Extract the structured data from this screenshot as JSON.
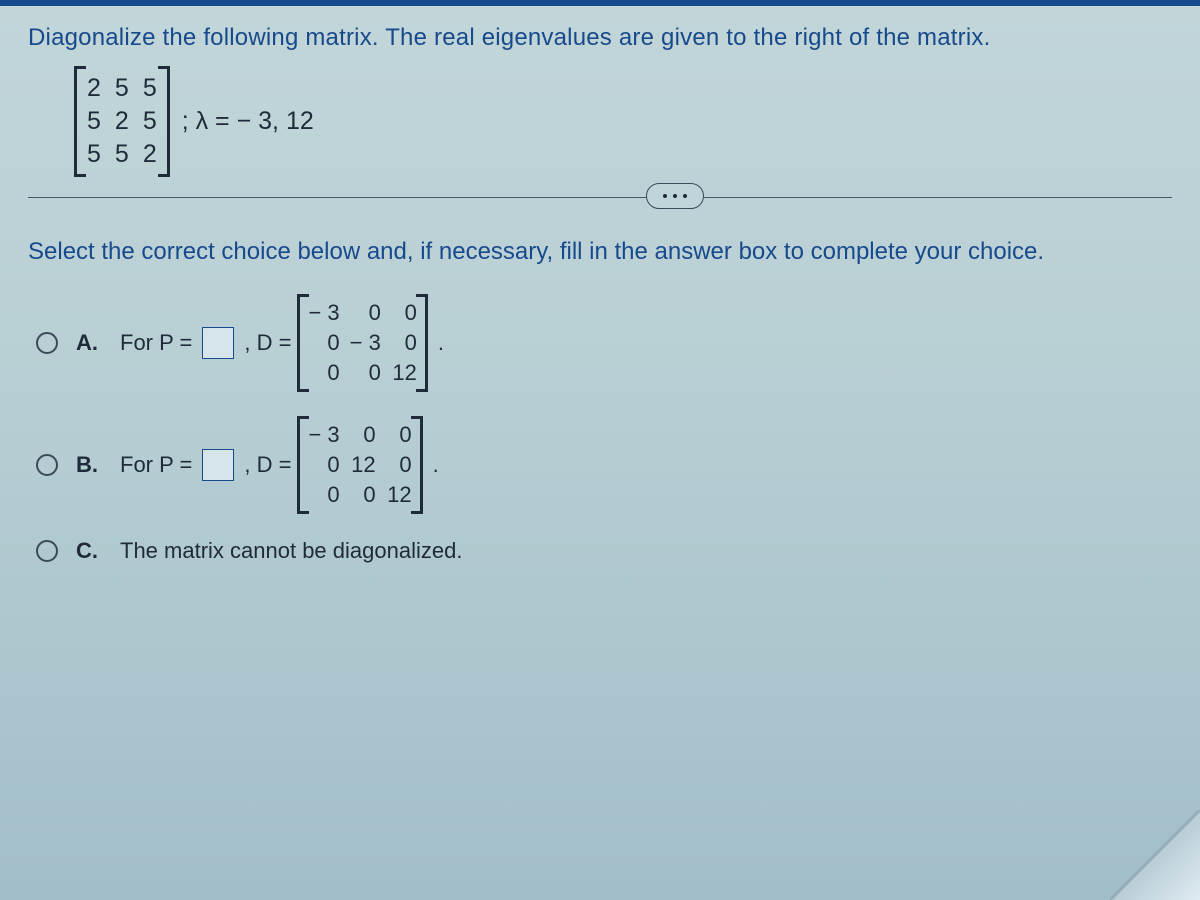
{
  "question": {
    "prompt": "Diagonalize the following matrix. The real eigenvalues are given to the right of the matrix.",
    "matrix": [
      [
        "2",
        "5",
        "5"
      ],
      [
        "5",
        "2",
        "5"
      ],
      [
        "5",
        "5",
        "2"
      ]
    ],
    "eigen_text": "; λ = − 3, 12"
  },
  "instruction": "Select the correct choice below and, if necessary, fill in the answer box to complete your choice.",
  "options": {
    "A": {
      "label": "A.",
      "prefix": "For P =",
      "mid": ", D =",
      "D": [
        [
          "− 3",
          "0",
          "0"
        ],
        [
          "0",
          "− 3",
          "0"
        ],
        [
          "0",
          "0",
          "12"
        ]
      ]
    },
    "B": {
      "label": "B.",
      "prefix": "For P =",
      "mid": ", D =",
      "D": [
        [
          "− 3",
          "0",
          "0"
        ],
        [
          "0",
          "12",
          "0"
        ],
        [
          "0",
          "0",
          "12"
        ]
      ]
    },
    "C": {
      "label": "C.",
      "text": "The matrix cannot be diagonalized."
    }
  }
}
